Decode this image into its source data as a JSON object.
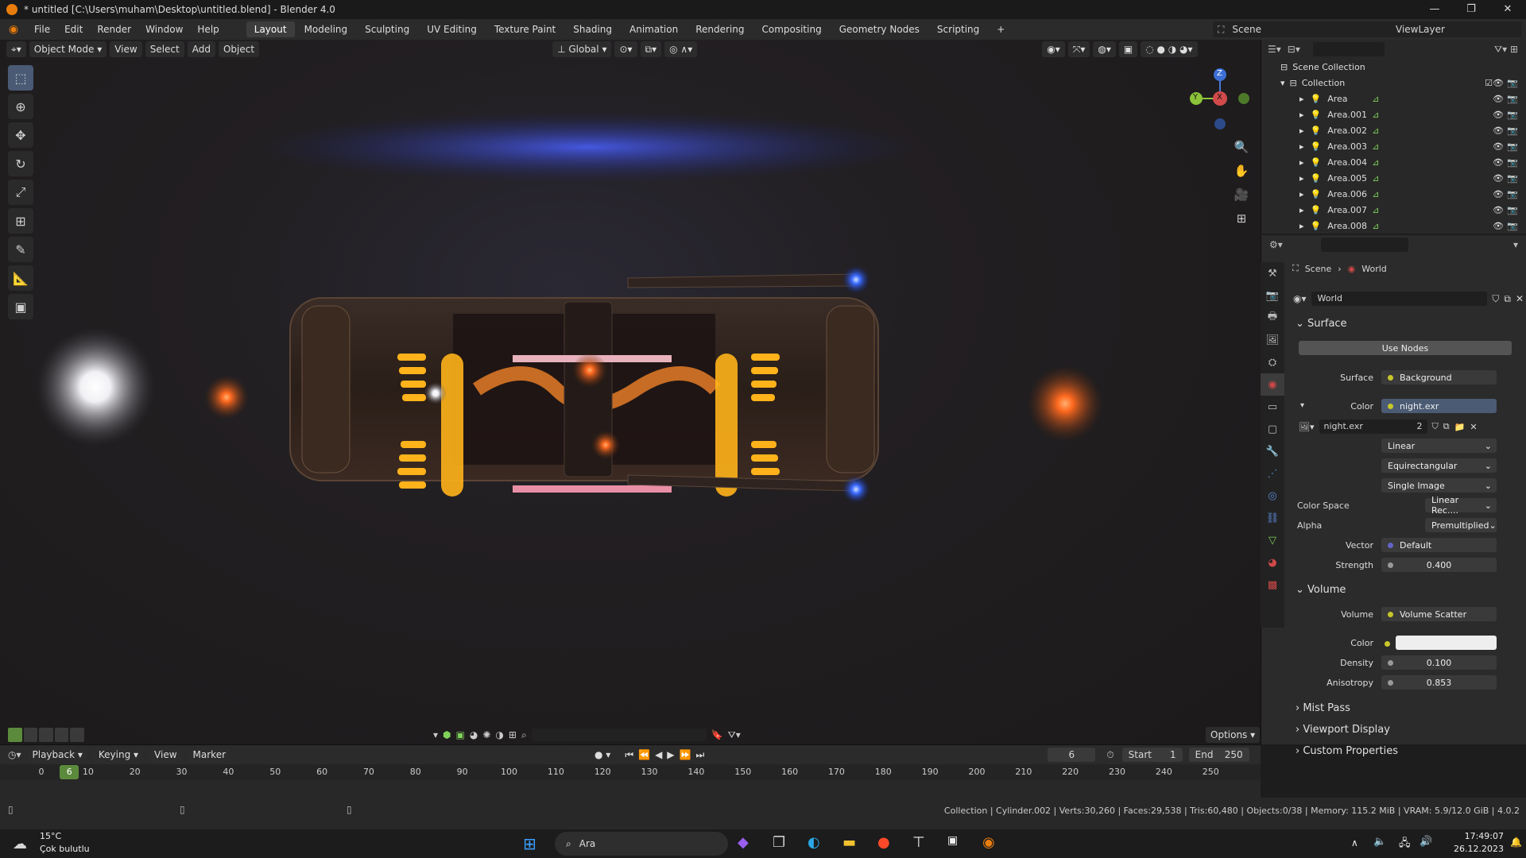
{
  "window": {
    "title": "* untitled [C:\\Users\\muham\\Desktop\\untitled.blend] - Blender 4.0",
    "controls": [
      "—",
      "❐",
      "✕"
    ]
  },
  "menus": [
    "File",
    "Edit",
    "Render",
    "Window",
    "Help"
  ],
  "workspaces": [
    "Layout",
    "Modeling",
    "Sculpting",
    "UV Editing",
    "Texture Paint",
    "Shading",
    "Animation",
    "Rendering",
    "Compositing",
    "Geometry Nodes",
    "Scripting",
    "+"
  ],
  "scene": {
    "label": "Scene",
    "view_layer": "ViewLayer"
  },
  "viewport_header": {
    "mode": "Object Mode",
    "view": "View",
    "select": "Select",
    "add": "Add",
    "object": "Object",
    "transform": "Global",
    "options": "Options"
  },
  "outliner": {
    "root": "Scene Collection",
    "collection": "Collection",
    "items": [
      "Area",
      "Area.001",
      "Area.002",
      "Area.003",
      "Area.004",
      "Area.005",
      "Area.006",
      "Area.007",
      "Area.008"
    ]
  },
  "properties": {
    "breadcrumb_scene": "Scene",
    "breadcrumb_world": "World",
    "world_name": "World",
    "surface_section": "Surface",
    "use_nodes": "Use Nodes",
    "surface_label": "Surface",
    "surface_value": "Background",
    "color_label": "Color",
    "color_value": "night.exr",
    "image_name": "night.exr",
    "image_users": "2",
    "interpolation": "Linear",
    "projection": "Equirectangular",
    "source": "Single Image",
    "color_space_label": "Color Space",
    "color_space_value": "Linear Rec....",
    "alpha_label": "Alpha",
    "alpha_value": "Premultiplied",
    "vector_label": "Vector",
    "vector_value": "Default",
    "strength_label": "Strength",
    "strength_value": "0.400",
    "volume_section": "Volume",
    "volume_label": "Volume",
    "volume_value": "Volume Scatter",
    "vcolor_label": "Color",
    "density_label": "Density",
    "density_value": "0.100",
    "anisotropy_label": "Anisotropy",
    "anisotropy_value": "0.853",
    "mist_pass": "Mist Pass",
    "viewport_display": "Viewport Display",
    "custom_properties": "Custom Properties"
  },
  "timeline": {
    "playback": "Playback",
    "keying": "Keying",
    "view": "View",
    "marker": "Marker",
    "current_frame": "6",
    "start_label": "Start",
    "start_value": "1",
    "end_label": "End",
    "end_value": "250",
    "ticks": [
      "0",
      "10",
      "20",
      "30",
      "40",
      "50",
      "60",
      "70",
      "80",
      "90",
      "100",
      "110",
      "120",
      "130",
      "140",
      "150",
      "160",
      "170",
      "180",
      "190",
      "200",
      "210",
      "220",
      "230",
      "240",
      "250"
    ]
  },
  "statusbar": {
    "text": "Collection | Cylinder.002 | Verts:30,260 | Faces:29,538 | Tris:60,480 | Objects:0/38 | Memory: 115.2 MiB | VRAM: 5.9/12.0 GiB | 4.0.2"
  },
  "taskbar": {
    "weather_temp": "15°C",
    "weather_desc": "Çok bulutlu",
    "search": "Ara",
    "time": "17:49:07",
    "date": "26.12.2023"
  },
  "gizmo": {
    "x": "X",
    "y": "Y",
    "z": "Z"
  },
  "colors": {
    "accent": "#4772b3",
    "active_frame": "#5c8a3c",
    "world_icon": "#c0392b"
  }
}
